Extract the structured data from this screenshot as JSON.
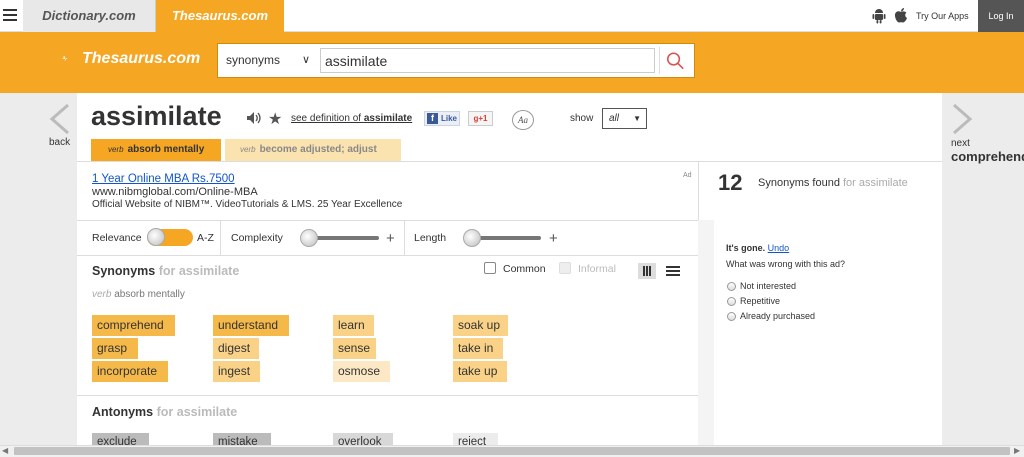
{
  "topnav": {
    "tab_dictionary": "Dictionary.com",
    "tab_thesaurus": "Thesaurus.com",
    "try_apps": "Try Our Apps",
    "login": "Log In"
  },
  "header": {
    "logo_text": "Thesaurus.com",
    "search_type": "synonyms",
    "search_value": "assimilate",
    "accent_color": "#f5a623"
  },
  "nav": {
    "back_label": "back",
    "next_label": "next",
    "next_word": "comprehend"
  },
  "entry": {
    "word": "assimilate",
    "see_definition_prefix": "see definition of ",
    "see_definition_word": "assimilate",
    "fb_like": "Like",
    "gplus": "+1",
    "aa": "Aa",
    "show_label": "show",
    "show_value": "all"
  },
  "senses": [
    {
      "pos": "verb",
      "label": "absorb mentally",
      "active": true
    },
    {
      "pos": "verb",
      "label": "become adjusted; adjust",
      "active": false
    }
  ],
  "ad": {
    "title": "1 Year Online MBA Rs.7500",
    "url": "www.nibmglobal.com/Online-MBA",
    "desc": "Official Website of NIBM™. VideoTutorials & LMS. 25 Year Excellence",
    "tag": "Ad"
  },
  "found": {
    "count": "12",
    "text": "Synonyms found",
    "suffix": "for assimilate"
  },
  "filters": {
    "relevance": "Relevance",
    "az": "A-Z",
    "complexity": "Complexity",
    "length": "Length",
    "plus": "+"
  },
  "synonyms": {
    "heading": "Synonyms",
    "heading_suffix": "for assimilate",
    "sense_pos": "verb",
    "sense_label": "absorb mentally",
    "common": "Common",
    "informal": "Informal",
    "words": [
      {
        "word": "comprehend",
        "level": 3
      },
      {
        "word": "grasp",
        "level": 3
      },
      {
        "word": "incorporate",
        "level": 3
      },
      {
        "word": "understand",
        "level": 3
      },
      {
        "word": "digest",
        "level": 2
      },
      {
        "word": "ingest",
        "level": 1
      },
      {
        "word": "learn",
        "level": 2
      },
      {
        "word": "sense",
        "level": 2
      },
      {
        "word": "osmose",
        "level": 1
      },
      {
        "word": "soak up",
        "level": 2
      },
      {
        "word": "take in",
        "level": 2
      },
      {
        "word": "take up",
        "level": 2
      }
    ]
  },
  "antonyms": {
    "heading": "Antonyms",
    "heading_suffix": "for assimilate",
    "words": [
      "exclude",
      "mistake",
      "overlook",
      "reject"
    ]
  },
  "feedback": {
    "gone": "It's gone.",
    "undo": "Undo",
    "question": "What was wrong with this ad?",
    "options": [
      "Not interested",
      "Repetitive",
      "Already purchased"
    ]
  }
}
